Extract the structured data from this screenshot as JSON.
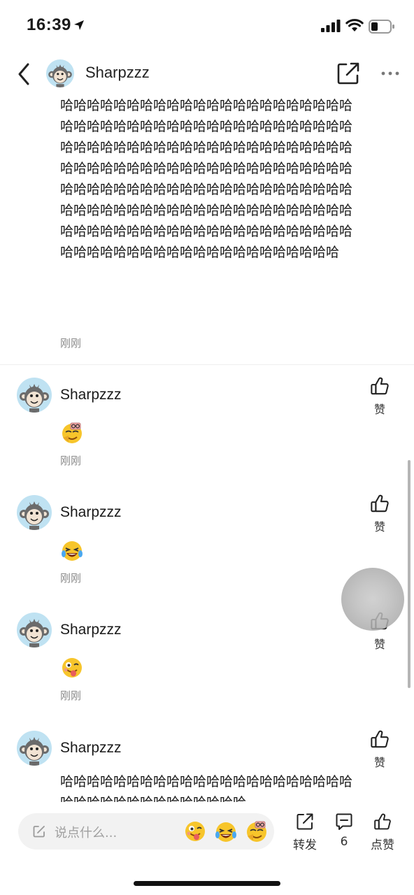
{
  "status_bar": {
    "time": "16:39"
  },
  "header": {
    "username": "Sharpzzz"
  },
  "post": {
    "text": "哈哈哈哈哈哈哈哈哈哈哈哈哈哈哈哈哈哈哈哈哈哈哈哈哈哈哈哈哈哈哈哈哈哈哈哈哈哈哈哈哈哈哈哈哈哈哈哈哈哈哈哈哈哈哈哈哈哈哈哈哈哈哈哈哈哈哈哈哈哈哈哈哈哈哈哈哈哈哈哈哈哈哈哈哈哈哈哈哈哈哈哈哈哈哈哈哈哈哈哈哈哈哈哈哈哈哈哈哈哈哈哈哈哈哈哈哈哈哈哈哈哈哈哈哈哈哈哈哈哈哈哈哈哈哈哈哈哈哈哈哈哈哈哈哈哈哈哈哈哈哈哈哈哈哈哈哈哈哈哈哈哈哈哈哈哈哈哈哈哈哈哈哈哈哈",
    "time": "刚刚"
  },
  "comments": [
    {
      "username": "Sharpzzz",
      "emoji": "nerd-glasses-emoji",
      "time": "刚刚",
      "like_label": "赞"
    },
    {
      "username": "Sharpzzz",
      "emoji": "laugh-cry-emoji",
      "time": "刚刚",
      "like_label": "赞"
    },
    {
      "username": "Sharpzzz",
      "emoji": "tongue-wink-emoji",
      "time": "刚刚",
      "like_label": "赞"
    },
    {
      "username": "Sharpzzz",
      "text": "哈哈哈哈哈哈哈哈哈哈哈哈哈哈哈哈哈哈哈哈哈哈哈哈哈哈哈哈哈哈哈哈哈哈哈哈",
      "like_label": "赞"
    }
  ],
  "bottom_bar": {
    "placeholder": "说点什么...",
    "quick_emojis": [
      "tongue-wink-emoji",
      "laugh-cry-emoji",
      "nerd-glasses-emoji"
    ],
    "share_label": "转发",
    "comment_count": "6",
    "like_label": "点赞"
  }
}
